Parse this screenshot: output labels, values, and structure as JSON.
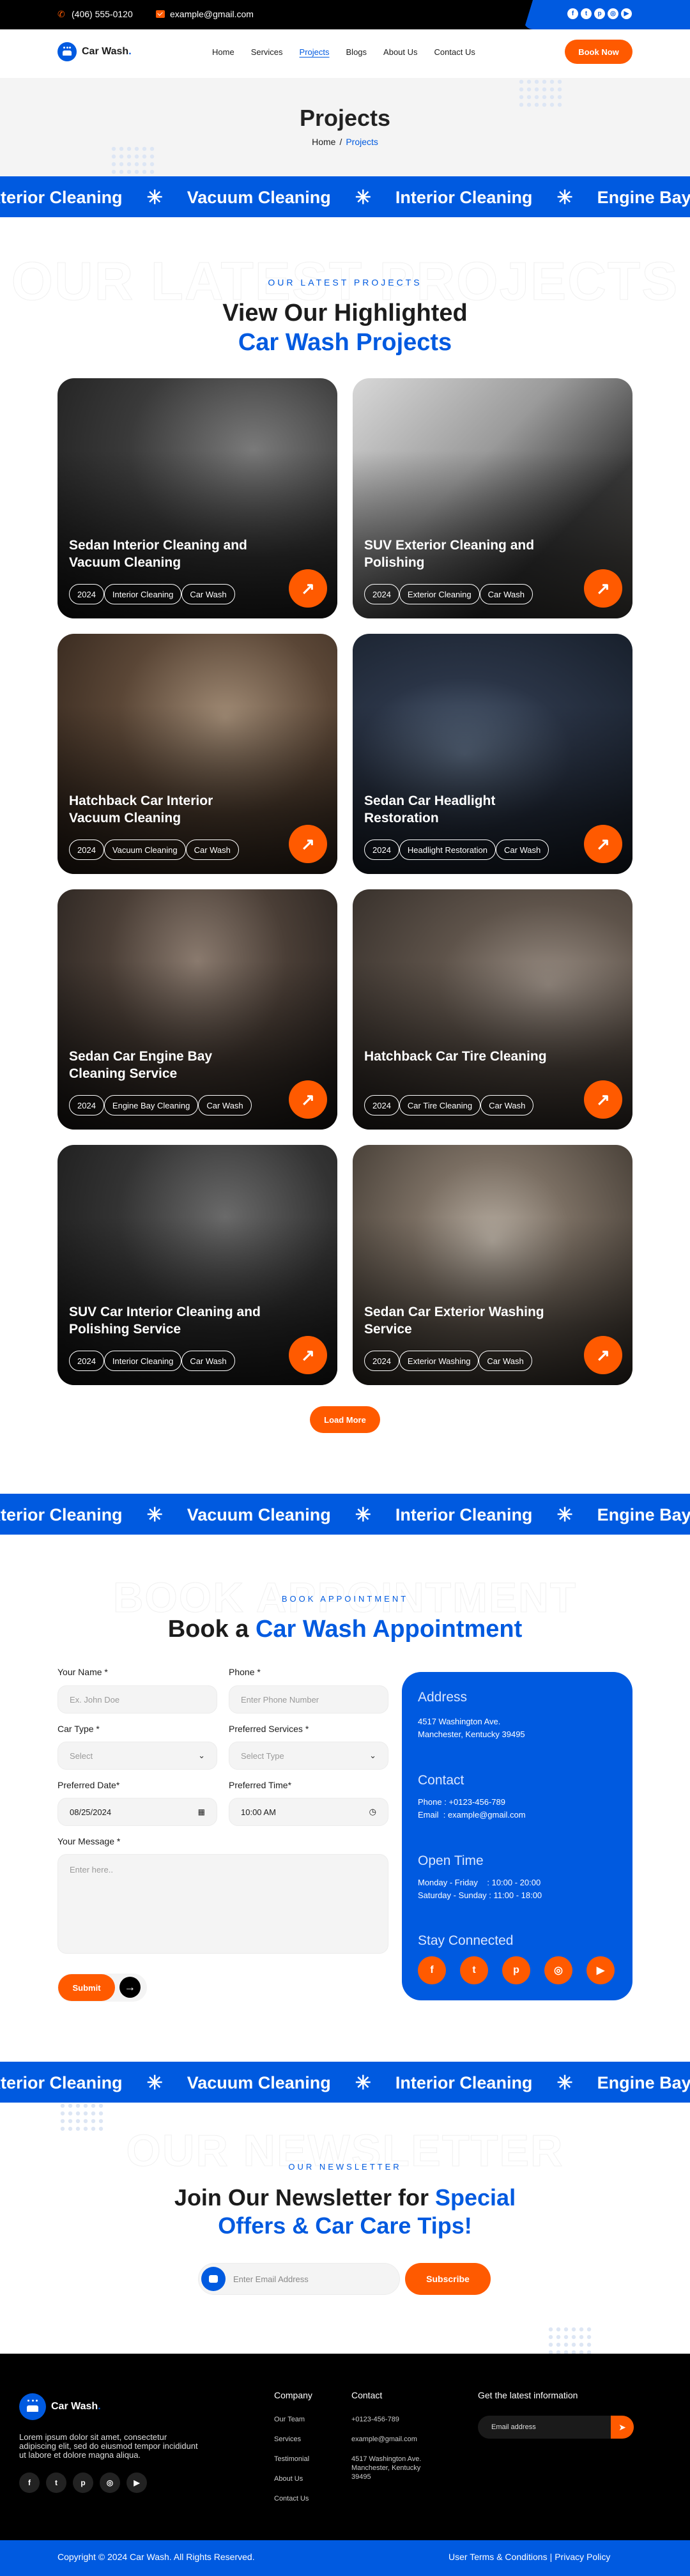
{
  "topbar": {
    "phone": "(406) 555-0120",
    "email": "example@gmail.com",
    "social": [
      "facebook",
      "twitter",
      "pinterest",
      "instagram",
      "youtube"
    ]
  },
  "nav": {
    "brand": "Car Wash",
    "brand_dot": ".",
    "items": [
      {
        "label": "Home",
        "active": false
      },
      {
        "label": "Services",
        "active": false
      },
      {
        "label": "Projects",
        "active": true
      },
      {
        "label": "Blogs",
        "active": false
      },
      {
        "label": "About Us",
        "active": false
      },
      {
        "label": "Contact Us",
        "active": false
      }
    ],
    "cta": "Book Now"
  },
  "hero": {
    "title": "Projects",
    "breadcrumb": {
      "home": "Home",
      "sep": "/",
      "current": "Projects"
    }
  },
  "marquee": {
    "items": [
      "Exterior Cleaning",
      "Vacuum Cleaning",
      "Interior Cleaning",
      "Engine Bay Cleaning"
    ],
    "separator": "✳"
  },
  "projects": {
    "eyebrow": "OUR LATEST PROJECTS",
    "ghost": "OUR LATEST PROJECTS",
    "heading_dark": "View Our Highlighted",
    "heading_blue": "Car Wash Projects",
    "cards": [
      {
        "title": "Sedan Interior Cleaning and Vacuum Cleaning",
        "tags": [
          "2024",
          "Interior Cleaning",
          "Car Wash"
        ]
      },
      {
        "title": "SUV Exterior Cleaning and Polishing",
        "tags": [
          "2024",
          "Exterior Cleaning",
          "Car Wash"
        ]
      },
      {
        "title": "Hatchback Car Interior Vacuum Cleaning",
        "tags": [
          "2024",
          "Vacuum Cleaning",
          "Car Wash"
        ]
      },
      {
        "title": "Sedan Car Headlight Restoration",
        "tags": [
          "2024",
          "Headlight Restoration",
          "Car Wash"
        ]
      },
      {
        "title": "Sedan Car Engine Bay Cleaning Service",
        "tags": [
          "2024",
          "Engine Bay Cleaning",
          "Car Wash"
        ]
      },
      {
        "title": "Hatchback Car Tire Cleaning",
        "tags": [
          "2024",
          "Car Tire Cleaning",
          "Car Wash"
        ]
      },
      {
        "title": "SUV Car Interior Cleaning and Polishing Service",
        "tags": [
          "2024",
          "Interior Cleaning",
          "Car Wash"
        ]
      },
      {
        "title": "Sedan Car Exterior Washing Service",
        "tags": [
          "2024",
          "Exterior Washing",
          "Car Wash"
        ]
      }
    ],
    "load_more": "Load More"
  },
  "booking": {
    "eyebrow": "BOOK APPOINTMENT",
    "ghost": "BOOK APPOINTMENT",
    "heading_dark": "Book a ",
    "heading_blue": "Car Wash Appointment",
    "fields": {
      "name_label": "Your Name *",
      "name_placeholder": "Ex. John Doe",
      "phone_label": "Phone *",
      "phone_placeholder": "Enter Phone Number",
      "car_label": "Car Type *",
      "car_value": "Select",
      "service_label": "Preferred Services *",
      "service_value": "Select Type",
      "date_label": "Preferred Date*",
      "date_value": "08/25/2024",
      "time_label": "Preferred Time*",
      "time_value": "10:00 AM",
      "message_label": "Your Message *",
      "message_placeholder": "Enter here.."
    },
    "submit": "Submit",
    "info": {
      "address_title": "Address",
      "address": "4517 Washington Ave.\nManchester, Kentucky 39495",
      "contact_title": "Contact",
      "contact": "Phone : +0123-456-789\nEmail  : example@gmail.com",
      "hours_title": "Open Time",
      "hours": "Monday - Friday    : 10:00 - 20:00\nSaturday - Sunday : 11:00 - 18:00",
      "social_title": "Stay Connected"
    }
  },
  "newsletter": {
    "eyebrow": "OUR NEWSLETTER",
    "ghost": "OUR NEWSLETTER",
    "heading_dark": "Join Our Newsletter for ",
    "heading_blue_1": "Special",
    "heading_blue_2": "Offers & Car Care Tips!",
    "placeholder": "Enter Email Address",
    "button": "Subscribe"
  },
  "footer": {
    "brand": "Car Wash",
    "description": "Lorem ipsum dolor sit amet, consectetur adipiscing elit, sed do eiusmod tempor incididunt ut labore et dolore magna aliqua.",
    "company_title": "Company",
    "company_links": [
      "Our Team",
      "Services",
      "Testimonial",
      "About Us",
      "Contact Us"
    ],
    "contact_title": "Contact",
    "contact_phone": "+0123-456-789",
    "contact_email": "example@gmail.com",
    "contact_address": "4517 Washington Ave.\nManchester, Kentucky\n39495",
    "info_title": "Get the latest information",
    "email_placeholder": "Email address",
    "copyright": "Copyright © 2024 Car Wash. All Rights Reserved.",
    "terms": "User Terms & Conditions",
    "privacy": "Privacy Policy"
  },
  "colors": {
    "primary": "#005ae0",
    "accent": "#ff5a00",
    "dark": "#000000"
  }
}
